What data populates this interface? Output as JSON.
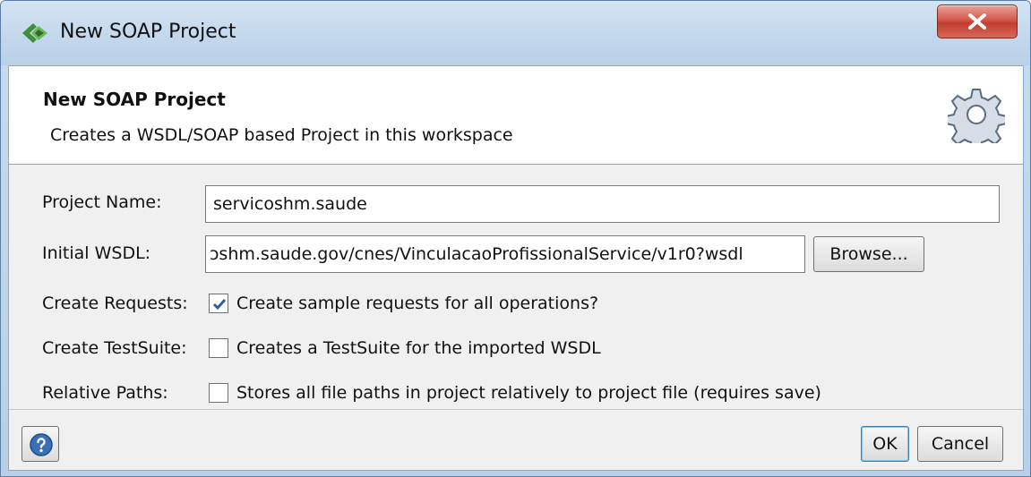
{
  "window": {
    "title": "New SOAP Project",
    "app_icon": "soapui-icon",
    "close_icon": "close-icon"
  },
  "header": {
    "title": "New SOAP Project",
    "subtitle": "Creates a WSDL/SOAP based Project in this workspace",
    "icon": "gear-icon"
  },
  "form": {
    "project_name_label": "Project Name:",
    "project_name_value": "servicoshm.saude",
    "initial_wsdl_label": "Initial WSDL:",
    "initial_wsdl_value": "ɔshm.saude.gov/cnes/VinculacaoProfissionalService/v1r0?wsdl",
    "browse_label": "Browse...",
    "create_requests_label": "Create Requests:",
    "create_requests_text": "Create sample requests for all operations?",
    "create_requests_checked": true,
    "create_testsuite_label": "Create TestSuite:",
    "create_testsuite_text": "Creates a TestSuite for the imported WSDL",
    "create_testsuite_checked": false,
    "relative_paths_label": "Relative Paths:",
    "relative_paths_text": "Stores all file paths in project relatively to project file (requires save)",
    "relative_paths_checked": false
  },
  "footer": {
    "help_icon": "help-icon",
    "ok_label": "OK",
    "cancel_label": "Cancel"
  },
  "colors": {
    "title_bar": "#c2d7ec",
    "close_button": "#c33d2e",
    "checkbox_check": "#2f5f9e"
  }
}
